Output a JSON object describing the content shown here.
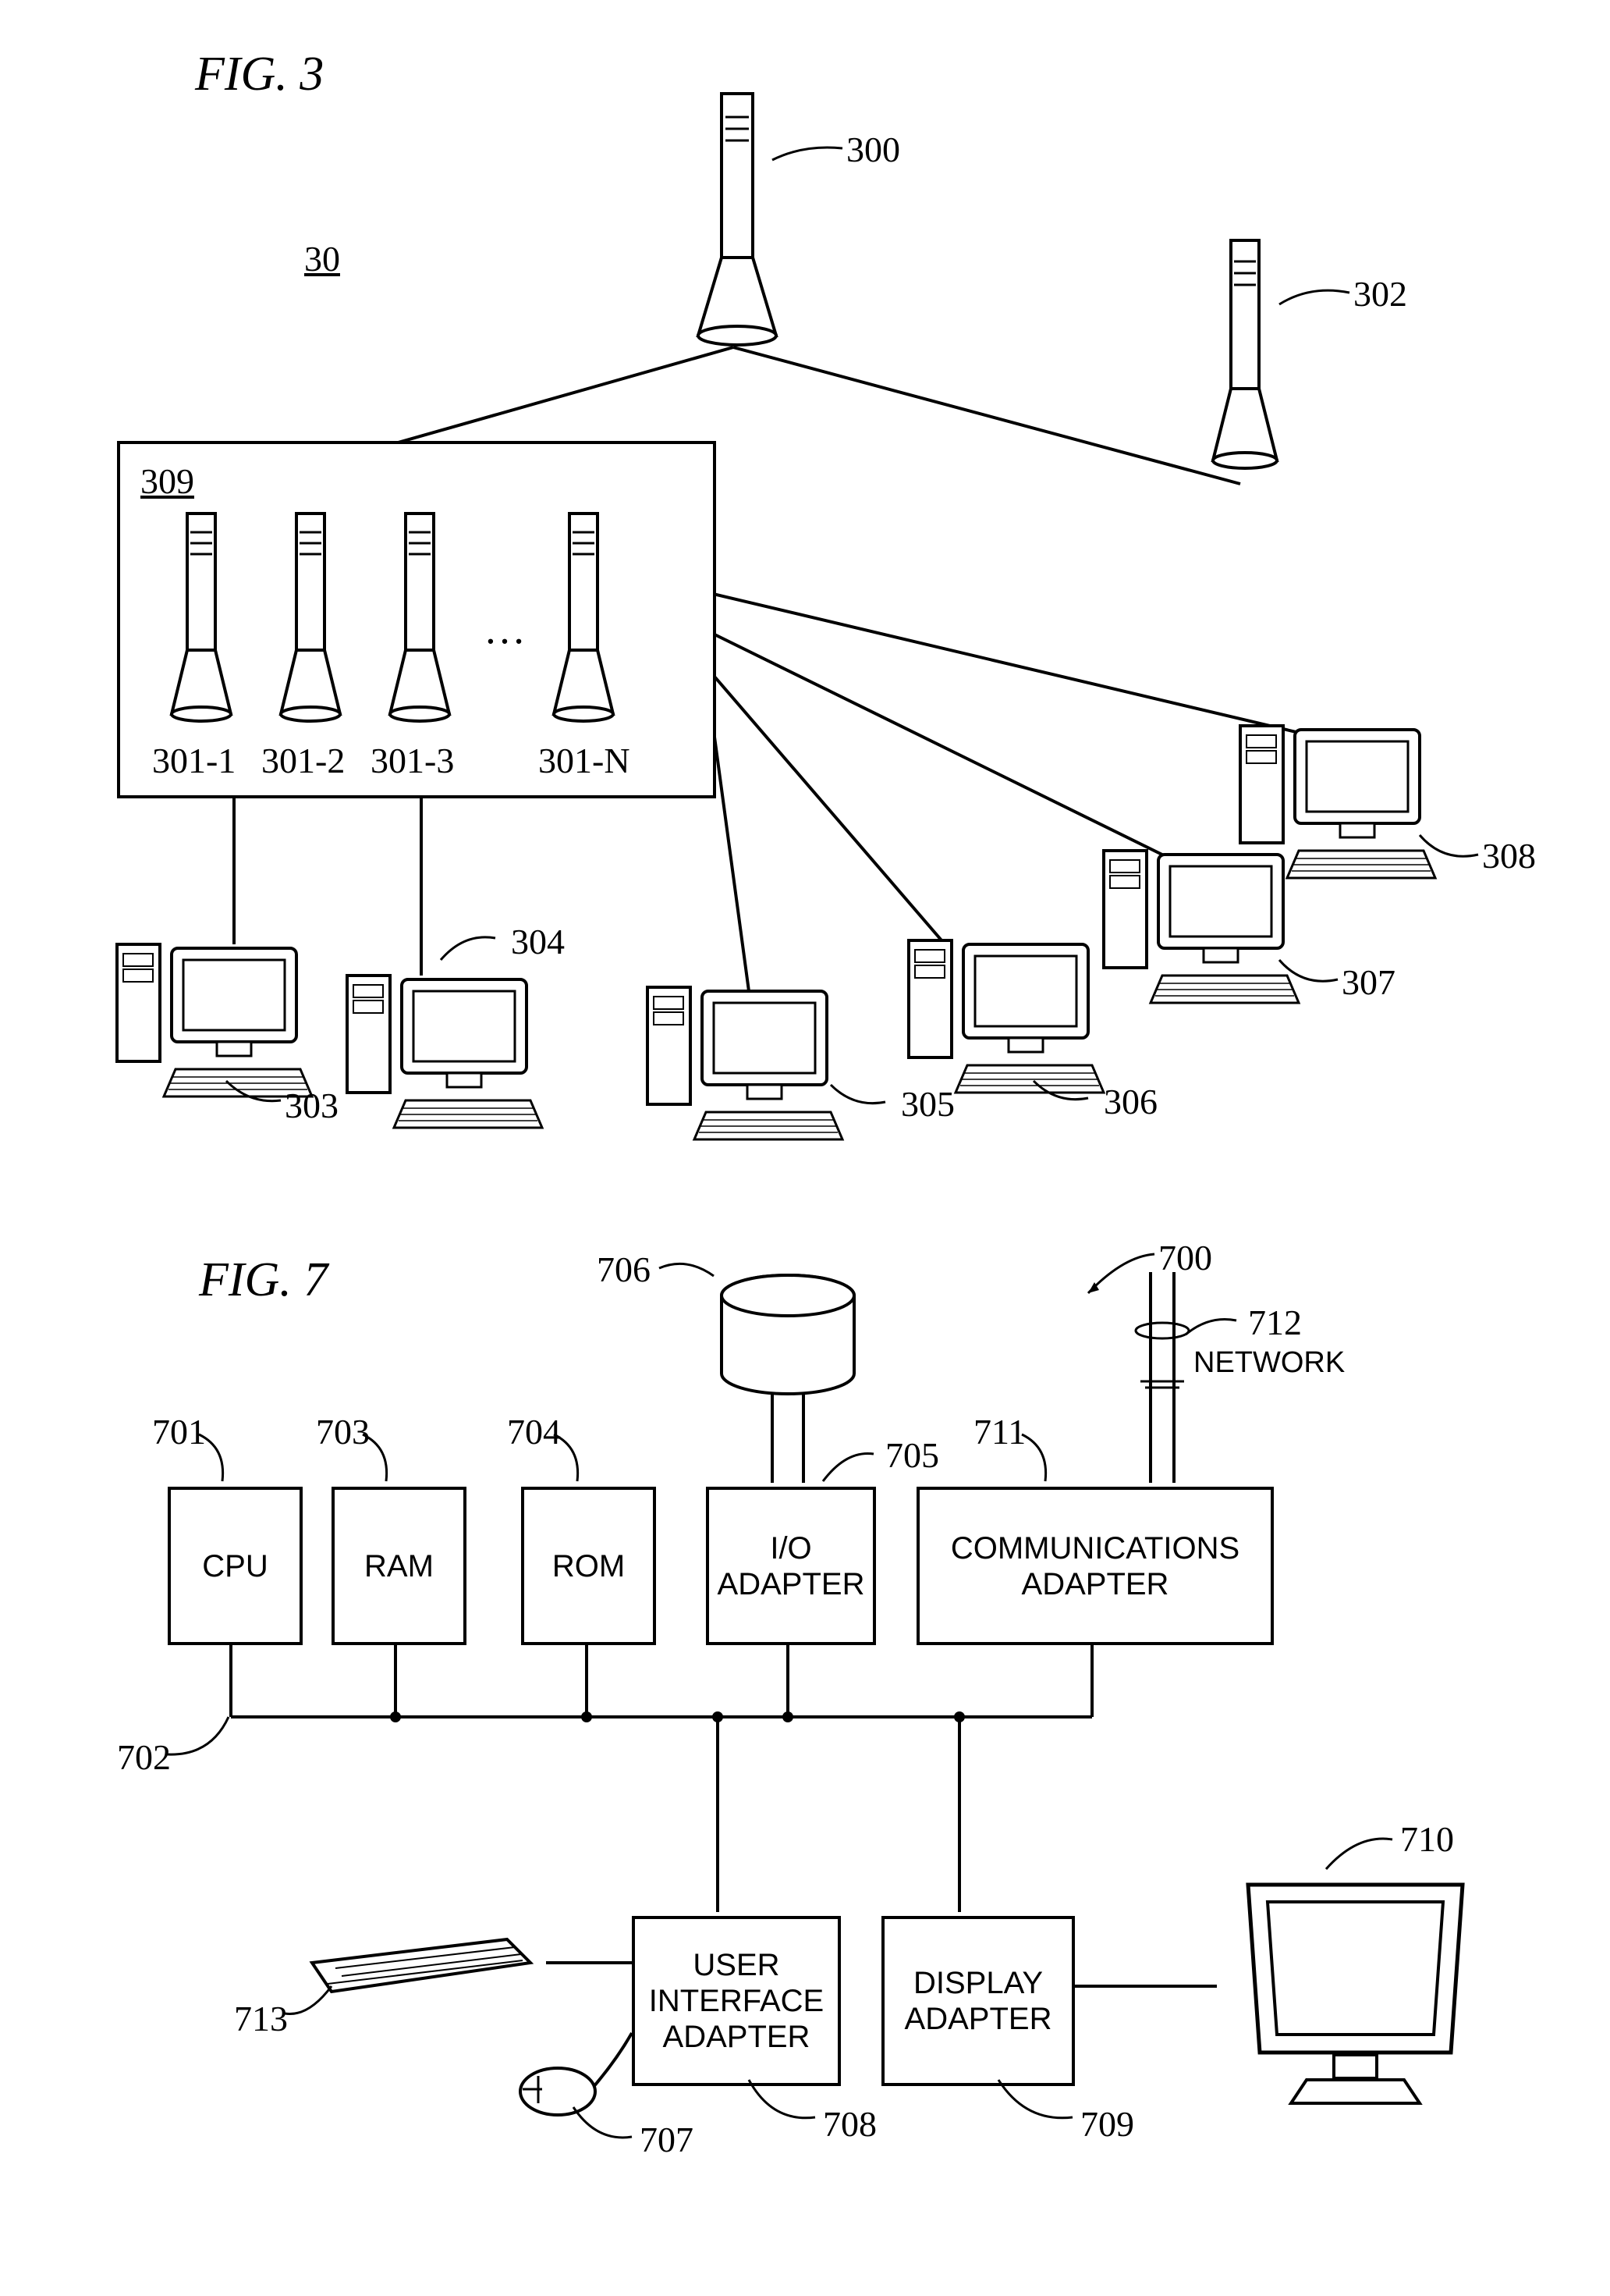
{
  "fig3": {
    "title": "FIG. 3",
    "system_ref": "30",
    "cluster_ref": "309",
    "server_main": "300",
    "server_right": "302",
    "servers": [
      "301-1",
      "301-2",
      "301-3",
      "301-N"
    ],
    "ellipsis": "…",
    "pcs": [
      "303",
      "304",
      "305",
      "306",
      "307",
      "308"
    ]
  },
  "fig7": {
    "title": "FIG. 7",
    "system_ref": "700",
    "network_label": "NETWORK",
    "network_ref": "712",
    "disk_ref": "706",
    "blocks": {
      "cpu": {
        "label": "CPU",
        "ref": "701"
      },
      "ram": {
        "label": "RAM",
        "ref": "703"
      },
      "rom": {
        "label": "ROM",
        "ref": "704"
      },
      "io": {
        "label": "I/O\nADAPTER",
        "ref": "705"
      },
      "comm": {
        "label": "COMMUNICATIONS\nADAPTER",
        "ref": "711"
      },
      "ui": {
        "label": "USER\nINTERFACE\nADAPTER",
        "ref": "708"
      },
      "disp": {
        "label": "DISPLAY\nADAPTER",
        "ref": "709"
      }
    },
    "bus_ref": "702",
    "keyboard_ref": "713",
    "mouse_ref": "707",
    "monitor_ref": "710"
  }
}
